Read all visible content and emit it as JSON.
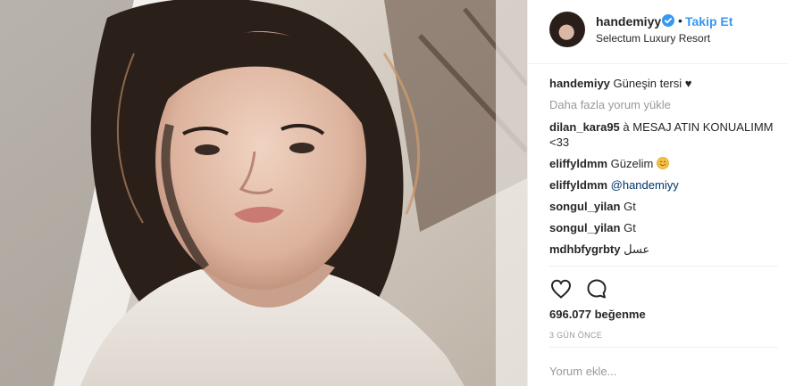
{
  "header": {
    "username": "handemiyy",
    "verified_icon": "verified-badge-icon",
    "separator": "•",
    "follow_label": "Takip Et",
    "location": "Selectum Luxury Resort"
  },
  "caption": {
    "username": "handemiyy",
    "text": "Güneşin tersi ♥"
  },
  "load_more_label": "Daha fazla yorum yükle",
  "comments": [
    {
      "username": "dilan_kara95",
      "text": "à MESAJ ATIN KONUALIMM <33"
    },
    {
      "username": "eliffyldmm",
      "text": "Güzelim",
      "emoji": "smiling-face-emoji"
    },
    {
      "username": "eliffyldmm",
      "text": "@handemiyy"
    },
    {
      "username": "songul_yilan",
      "text": "Gt"
    },
    {
      "username": "songul_yilan",
      "text": "Gt"
    },
    {
      "username": "mdhbfygrbty",
      "text": "عسل"
    }
  ],
  "actions": {
    "like_icon": "heart-icon",
    "comment_icon": "speech-bubble-icon"
  },
  "likes": "696.077 beğenme",
  "timestamp": "3 GÜN ÖNCE",
  "add_comment": {
    "placeholder": "Yorum ekle..."
  },
  "colors": {
    "link_blue": "#3897f0",
    "mention_blue": "#003569",
    "text": "#262626",
    "muted": "#999999",
    "divider": "#efefef"
  }
}
